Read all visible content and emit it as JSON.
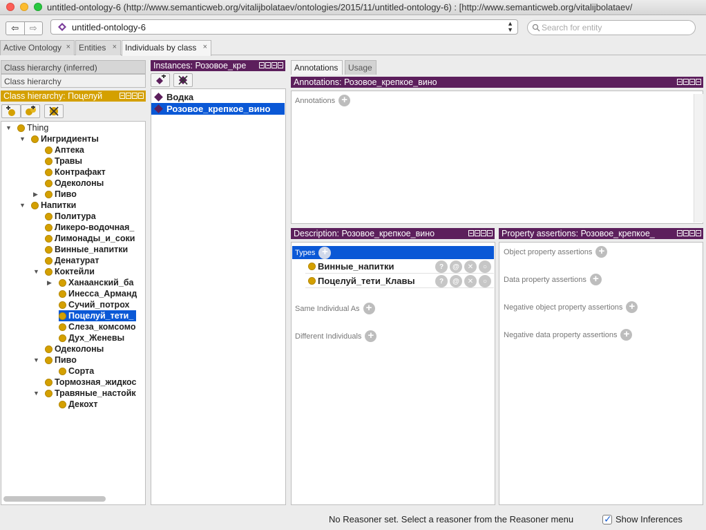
{
  "window": {
    "title": "untitled-ontology-6 (http://www.semanticweb.org/vitalijbolataev/ontologies/2015/11/untitled-ontology-6)  : [http://www.semanticweb.org/vitalijbolataev/"
  },
  "toolbar": {
    "back_label": "⇦",
    "forward_label": "⇨",
    "entity_selected": "untitled-ontology-6",
    "search_placeholder": "Search for entity"
  },
  "tabs": [
    {
      "label": "Active Ontology",
      "close": "×"
    },
    {
      "label": "Entities",
      "close": "×"
    },
    {
      "label": "Individuals by class",
      "close": "×"
    }
  ],
  "left": {
    "inferred_tab": "Class hierarchy (inferred)",
    "hierarchy_tab": "Class hierarchy",
    "header": "Class hierarchy: Поцелуй",
    "tree": [
      {
        "label": "Thing",
        "indent": 0,
        "toggle": "▼",
        "bold": false
      },
      {
        "label": "Ингридиенты",
        "indent": 1,
        "toggle": "▼"
      },
      {
        "label": "Аптека",
        "indent": 2,
        "toggle": ""
      },
      {
        "label": "Травы",
        "indent": 2,
        "toggle": ""
      },
      {
        "label": "Контрафакт",
        "indent": 2,
        "toggle": ""
      },
      {
        "label": "Одеколоны",
        "indent": 2,
        "toggle": ""
      },
      {
        "label": "Пиво",
        "indent": 2,
        "toggle": "▶"
      },
      {
        "label": "Напитки",
        "indent": 1,
        "toggle": "▼"
      },
      {
        "label": "Политура",
        "indent": 2,
        "toggle": ""
      },
      {
        "label": "Ликеро-водочная_",
        "indent": 2,
        "toggle": ""
      },
      {
        "label": "Лимонады_и_соки",
        "indent": 2,
        "toggle": ""
      },
      {
        "label": "Винные_напитки",
        "indent": 2,
        "toggle": ""
      },
      {
        "label": "Денатурат",
        "indent": 2,
        "toggle": ""
      },
      {
        "label": "Коктейли",
        "indent": 2,
        "toggle": "▼"
      },
      {
        "label": "Ханаанский_ба",
        "indent": 3,
        "toggle": "▶"
      },
      {
        "label": "Инесса_Арманд",
        "indent": 3,
        "toggle": ""
      },
      {
        "label": "Сучий_потрох",
        "indent": 3,
        "toggle": ""
      },
      {
        "label": "Поцелуй_тети_",
        "indent": 3,
        "toggle": "",
        "selected": true
      },
      {
        "label": "Слеза_комсомо",
        "indent": 3,
        "toggle": ""
      },
      {
        "label": "Дух_Женевы",
        "indent": 3,
        "toggle": ""
      },
      {
        "label": "Одеколоны",
        "indent": 2,
        "toggle": ""
      },
      {
        "label": "Пиво",
        "indent": 2,
        "toggle": "▼"
      },
      {
        "label": "Сорта",
        "indent": 3,
        "toggle": ""
      },
      {
        "label": "Тормозная_жидкос",
        "indent": 2,
        "toggle": ""
      },
      {
        "label": "Травяные_настойк",
        "indent": 2,
        "toggle": "▼"
      },
      {
        "label": "Декохт",
        "indent": 3,
        "toggle": ""
      }
    ]
  },
  "instances": {
    "header": "Instances: Розовое_кре",
    "items": [
      {
        "label": "Водка",
        "selected": false
      },
      {
        "label": "Розовое_крепкое_вино",
        "selected": true
      }
    ]
  },
  "right": {
    "subtabs": [
      "Annotations",
      "Usage"
    ],
    "annotations_header": "Annotations: Розовое_крепкое_вино",
    "annotations_label": "Annotations",
    "description_header": "Description: Розовое_крепкое_вино",
    "types_label": "Types",
    "types": [
      "Винные_напитки",
      "Поцелуй_тети_Клавы"
    ],
    "same_individual": "Same Individual As",
    "different_individuals": "Different Individuals",
    "property_header": "Property assertions: Розовое_крепкое_",
    "object_prop": "Object property assertions",
    "data_prop": "Data property assertions",
    "neg_object_prop": "Negative object property assertions",
    "neg_data_prop": "Negative data property assertions"
  },
  "status": {
    "reasoner": "No Reasoner set. Select a reasoner from the Reasoner menu",
    "show_inferences": "Show Inferences"
  },
  "colors": {
    "purple_header": "#5c1f5c",
    "gold_header": "#d4a000",
    "selection": "#0a58d6"
  }
}
